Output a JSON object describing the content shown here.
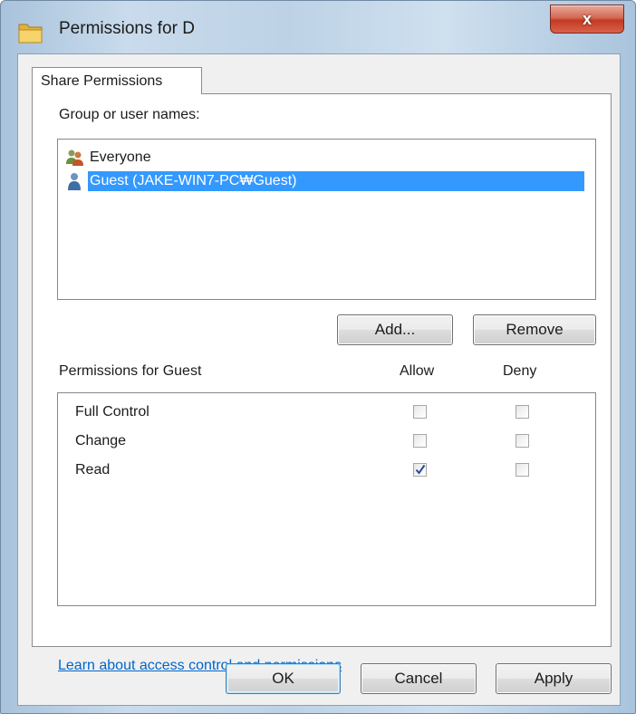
{
  "window": {
    "title": "Permissions for D",
    "close_label": "x"
  },
  "tabs": [
    {
      "label": "Share Permissions",
      "active": true
    }
  ],
  "users": {
    "label": "Group or user names:",
    "items": [
      {
        "name": "Everyone",
        "icon": "group-users-icon",
        "selected": false
      },
      {
        "name": "Guest (JAKE-WIN7-PC₩Guest)",
        "icon": "user-icon",
        "selected": true
      }
    ],
    "add_label": "Add...",
    "remove_label": "Remove"
  },
  "permissions": {
    "label": "Permissions for Guest",
    "allow_header": "Allow",
    "deny_header": "Deny",
    "rows": [
      {
        "name": "Full Control",
        "allow": false,
        "deny": false
      },
      {
        "name": "Change",
        "allow": false,
        "deny": false
      },
      {
        "name": "Read",
        "allow": true,
        "deny": false
      }
    ]
  },
  "help_link": "Learn about access control and permissions",
  "footer": {
    "ok_label": "OK",
    "cancel_label": "Cancel",
    "apply_label": "Apply"
  },
  "colors": {
    "selection": "#3399ff",
    "link": "#0066cc",
    "close_button": "#c13a23"
  }
}
